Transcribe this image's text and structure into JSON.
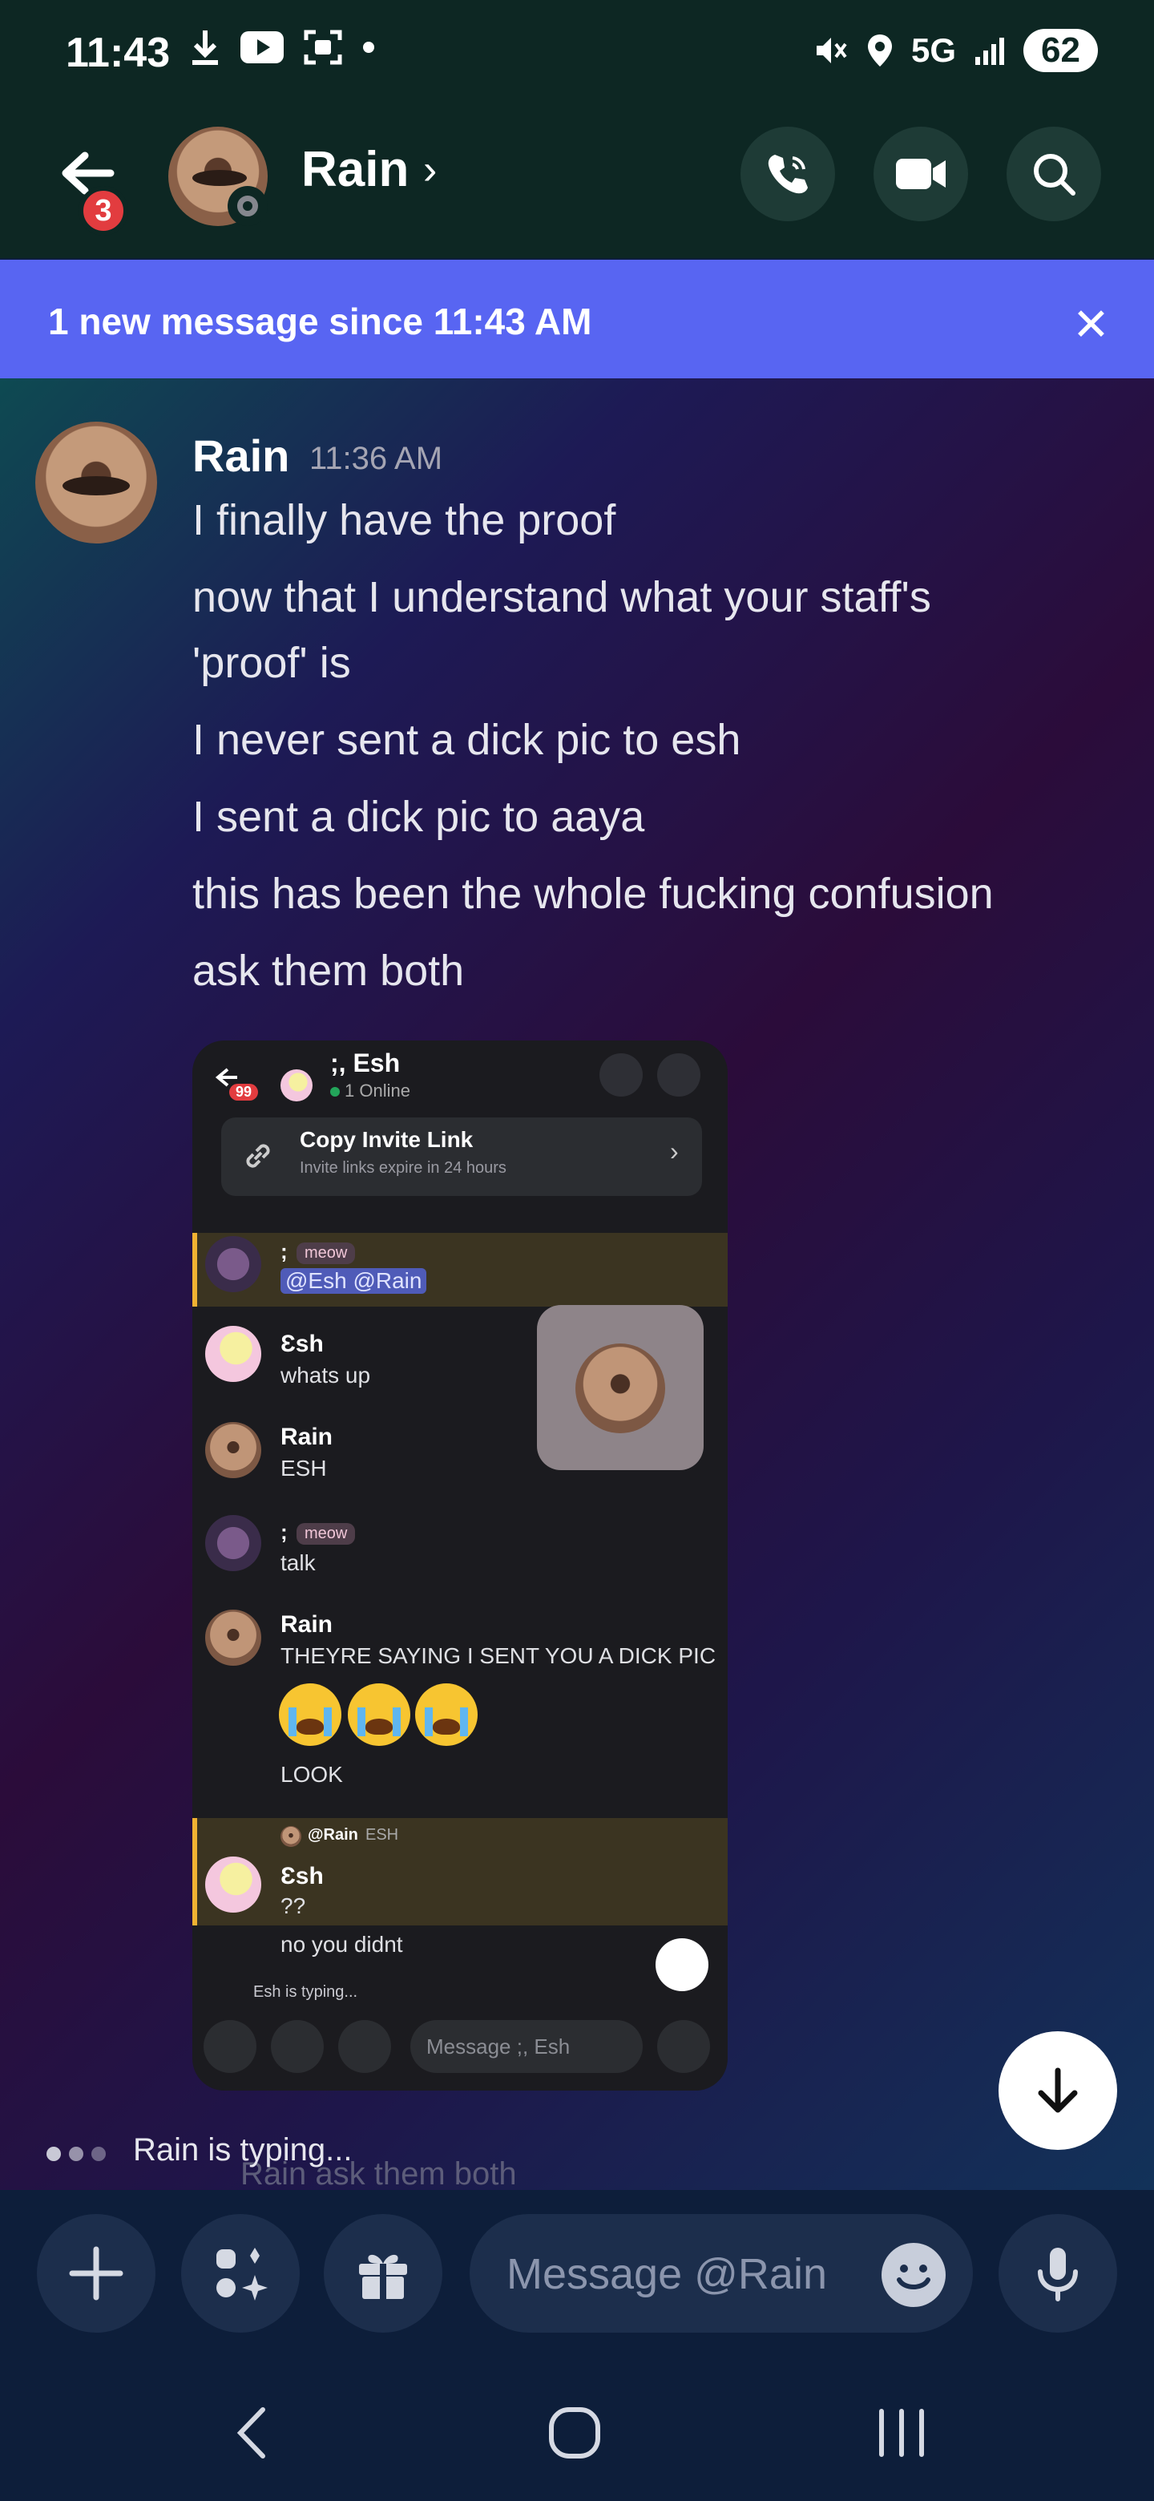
{
  "status_bar": {
    "time": "11:43",
    "network": "5G",
    "battery": "62",
    "left_icons": [
      "download-icon",
      "youtube-icon",
      "screenshot-icon",
      "dot-icon"
    ],
    "right_icons": [
      "mute-icon",
      "location-icon",
      "signal-icon"
    ]
  },
  "header": {
    "unread_count": "3",
    "title": "Rain",
    "chevron": "›",
    "actions": [
      "call-icon",
      "video-icon",
      "search-icon"
    ]
  },
  "banner": {
    "text": "1 new message since 11:43 AM",
    "close": "✕"
  },
  "message": {
    "author": "Rain",
    "timestamp": "11:36 AM",
    "lines": [
      "I finally have the proof",
      "now that I understand what your staff's",
      "'proof' is",
      "I never sent a dick pic to esh",
      "I sent a dick pic to aaya",
      "this has been the whole fucking confusion",
      "ask them both"
    ]
  },
  "embedded": {
    "badge": "99",
    "title": ";, Esh",
    "subtitle": "1 Online",
    "invite_title": "Copy Invite Link",
    "invite_sub": "Invite links expire in 24 hours",
    "user_semicolon": ";",
    "tag_meow": "meow",
    "mention": "@Esh @Rain",
    "esh_name": "Ɛsh",
    "esh_msg1": "whats up",
    "rain_name": "Rain",
    "rain_msg1": "ESH",
    "talk": "talk",
    "rain_msg2": "THEYRE SAYING I SENT YOU A DICK PIC",
    "look": "LOOK",
    "reply_ref": "@Rain",
    "reply_ref_text": "ESH",
    "esh_msg2": "??",
    "esh_msg3": "no you didnt",
    "typing": "Esh is typing...",
    "input_placeholder": "Message ;, Esh"
  },
  "typing": "Rain is typing...",
  "ghost_text": "Rain  ask them both",
  "composer": {
    "placeholder": "Message @Rain"
  },
  "colors": {
    "header_bg": "#0d2723",
    "banner_bg": "#5865f2",
    "composer_bg": "#0d1e3a"
  }
}
